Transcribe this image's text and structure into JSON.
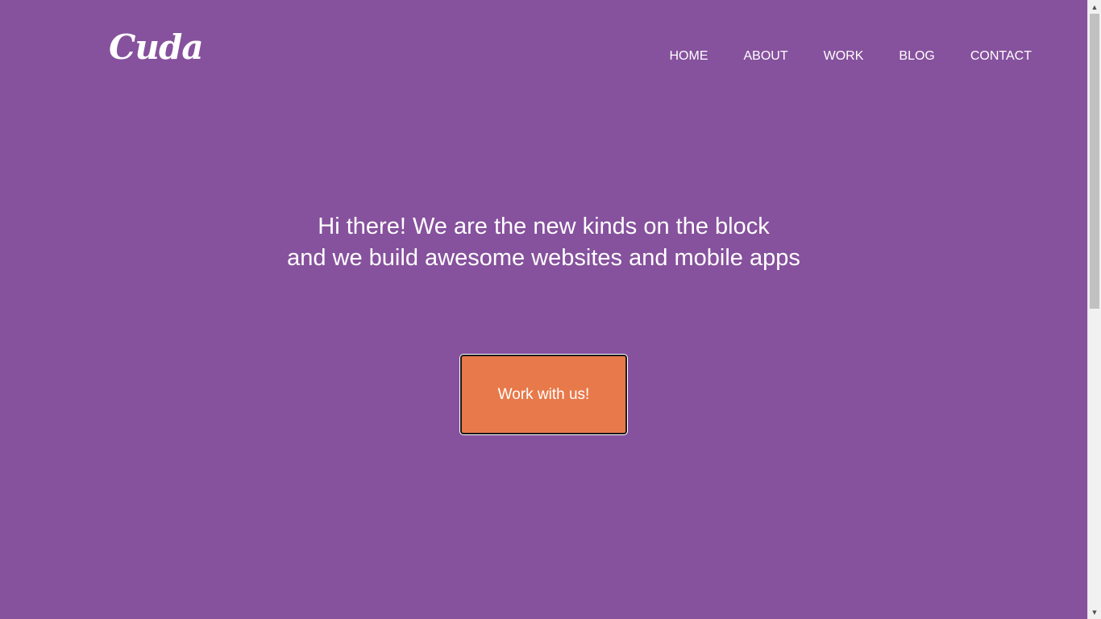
{
  "brand": {
    "logo_text": "Cuda"
  },
  "nav": {
    "items": [
      {
        "label": "HOME"
      },
      {
        "label": "ABOUT"
      },
      {
        "label": "WORK"
      },
      {
        "label": "BLOG"
      },
      {
        "label": "CONTACT"
      }
    ]
  },
  "hero": {
    "line1": "Hi there! We are the new kinds on the block",
    "line2": "and we build awesome websites and mobile apps",
    "cta_label": "Work with us!"
  },
  "colors": {
    "background": "#86519d",
    "cta_background": "#e8794a",
    "text": "#ffffff"
  },
  "scrollbar": {
    "up_icon": "triangle-up-icon",
    "down_icon": "triangle-down-icon"
  }
}
